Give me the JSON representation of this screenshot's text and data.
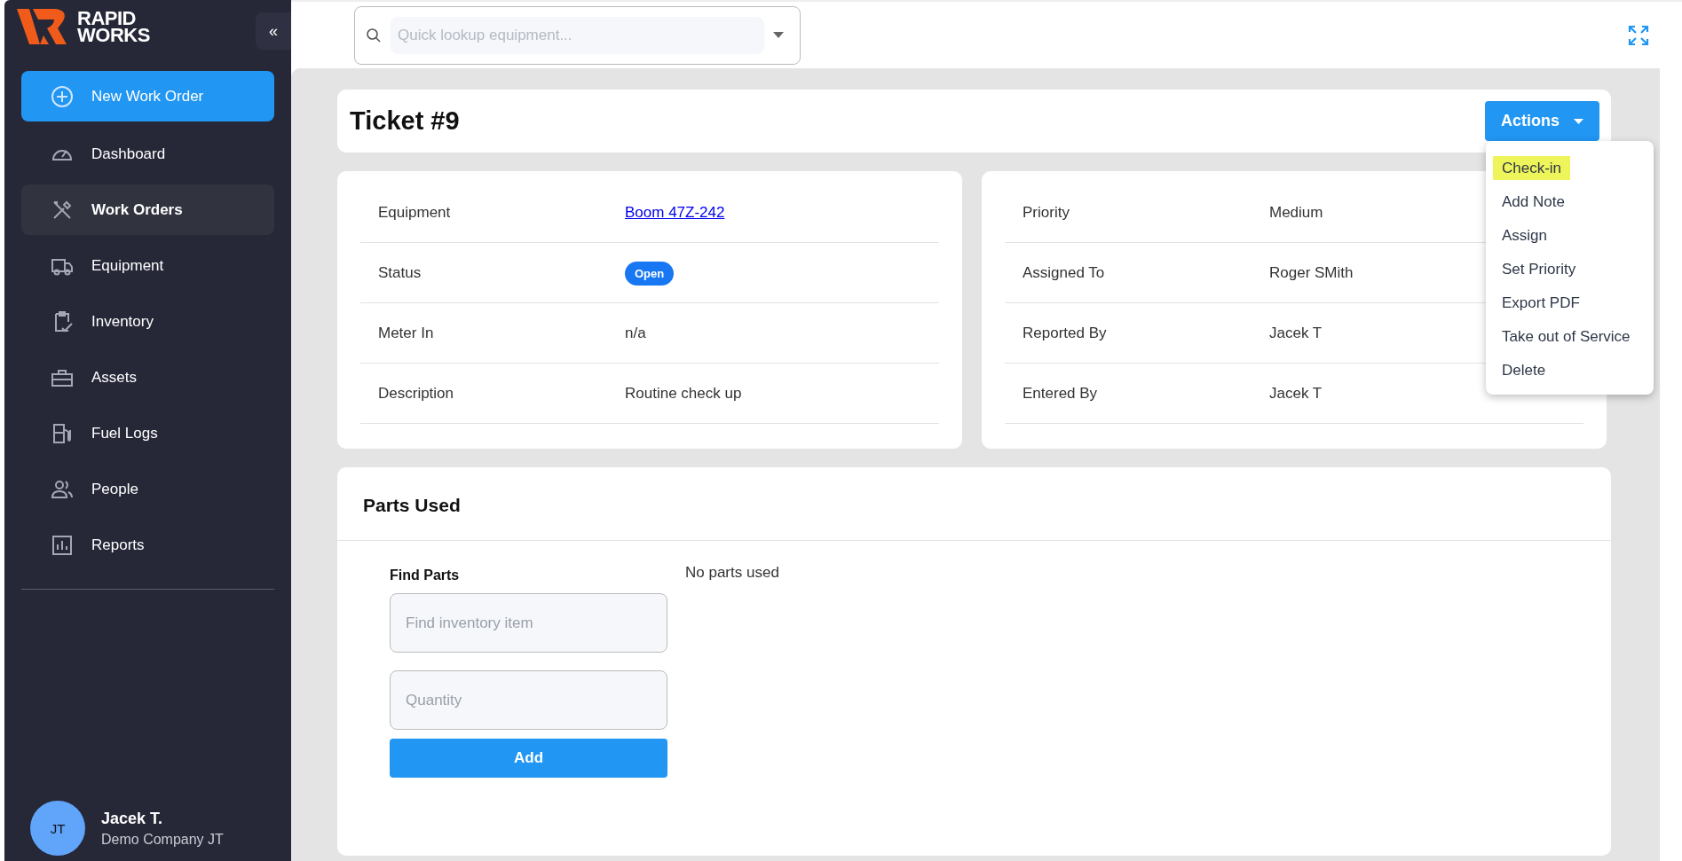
{
  "brand": {
    "line1": "RAPID",
    "line2": "WORKS"
  },
  "sidebar": {
    "collapse": "«",
    "primary_action": "New Work Order",
    "items": [
      {
        "label": "Dashboard",
        "selected": false
      },
      {
        "label": "Work Orders",
        "selected": true
      },
      {
        "label": "Equipment",
        "selected": false
      },
      {
        "label": "Inventory",
        "selected": false
      },
      {
        "label": "Assets",
        "selected": false
      },
      {
        "label": "Fuel Logs",
        "selected": false
      },
      {
        "label": "People",
        "selected": false
      },
      {
        "label": "Reports",
        "selected": false
      }
    ],
    "user": {
      "initials": "JT",
      "name": "Jacek T.",
      "company": "Demo Company JT"
    }
  },
  "search": {
    "placeholder": "Quick lookup equipment..."
  },
  "ticket": {
    "title": "Ticket #9"
  },
  "actions": {
    "label": "Actions",
    "menu": [
      {
        "label": "Check-in",
        "highlighted": true
      },
      {
        "label": "Add Note",
        "highlighted": false
      },
      {
        "label": "Assign",
        "highlighted": false
      },
      {
        "label": "Set Priority",
        "highlighted": false
      },
      {
        "label": "Export PDF",
        "highlighted": false
      },
      {
        "label": "Take out of Service",
        "highlighted": false
      },
      {
        "label": "Delete",
        "highlighted": false
      }
    ]
  },
  "details_left": [
    {
      "label": "Equipment",
      "value": "Boom 47Z-242",
      "kind": "link"
    },
    {
      "label": "Status",
      "value": "Open",
      "kind": "badge"
    },
    {
      "label": "Meter In",
      "value": "n/a",
      "kind": "text"
    },
    {
      "label": "Description",
      "value": "Routine check up",
      "kind": "text"
    }
  ],
  "details_right": [
    {
      "label": "Priority",
      "value": "Medium",
      "kind": "text"
    },
    {
      "label": "Assigned To",
      "value": "Roger SMith",
      "kind": "text"
    },
    {
      "label": "Reported By",
      "value": "Jacek T",
      "kind": "text"
    },
    {
      "label": "Entered By",
      "value": "Jacek T",
      "kind": "text"
    }
  ],
  "parts": {
    "title": "Parts Used",
    "find_label": "Find Parts",
    "find_placeholder": "Find inventory item",
    "quantity_placeholder": "Quantity",
    "add_button": "Add",
    "empty_text": "No parts used"
  }
}
